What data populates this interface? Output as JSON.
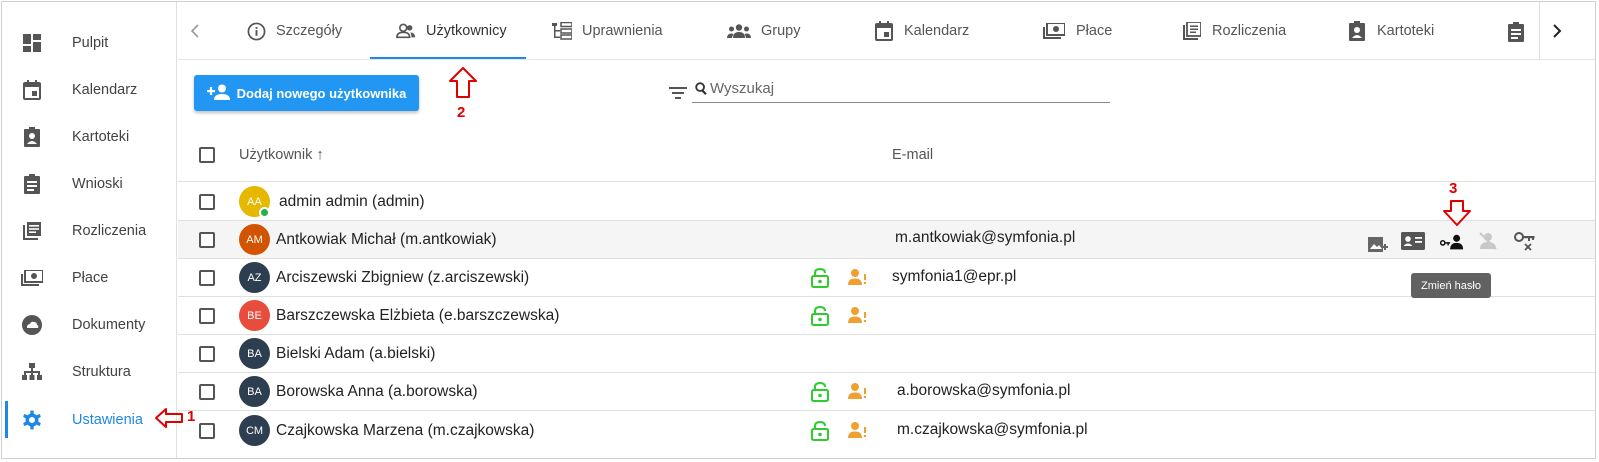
{
  "sidebar": {
    "items": [
      {
        "label": "Pulpit",
        "icon": "dashboard-icon"
      },
      {
        "label": "Kalendarz",
        "icon": "calendar-icon"
      },
      {
        "label": "Kartoteki",
        "icon": "badge-icon"
      },
      {
        "label": "Wnioski",
        "icon": "clipboard-icon"
      },
      {
        "label": "Rozliczenia",
        "icon": "list-icon"
      },
      {
        "label": "Płace",
        "icon": "money-icon"
      },
      {
        "label": "Dokumenty",
        "icon": "cloud-icon"
      },
      {
        "label": "Struktura",
        "icon": "hierarchy-icon"
      },
      {
        "label": "Ustawienia",
        "icon": "gear-icon",
        "active": true
      }
    ]
  },
  "tabs": {
    "items": [
      {
        "label": "Szczegóły",
        "icon": "info-icon"
      },
      {
        "label": "Użytkownicy",
        "icon": "users-icon",
        "active": true
      },
      {
        "label": "Uprawnienia",
        "icon": "tree-icon"
      },
      {
        "label": "Grupy",
        "icon": "groups-icon"
      },
      {
        "label": "Kalendarz",
        "icon": "calendar-icon"
      },
      {
        "label": "Płace",
        "icon": "money-icon"
      },
      {
        "label": "Rozliczenia",
        "icon": "list-icon"
      },
      {
        "label": "Kartoteki",
        "icon": "badge-icon"
      }
    ]
  },
  "toolbar": {
    "add_label": "Dodaj nowego użytkownika",
    "search_placeholder": "Wyszukaj"
  },
  "table": {
    "headers": {
      "user": "Użytkownik",
      "sort_arrow": "↑",
      "email": "E-mail"
    },
    "rows": [
      {
        "initials": "AA",
        "name": "admin admin (admin)",
        "email": "",
        "avatar_color": "#e6b800",
        "online": true,
        "lock": false,
        "warn": false
      },
      {
        "initials": "AM",
        "name": "Antkowiak Michał (m.antkowiak)",
        "email": "m.antkowiak@symfonia.pl",
        "avatar_color": "#d35400",
        "online": false,
        "lock": false,
        "warn": false,
        "hover": true
      },
      {
        "initials": "AZ",
        "name": "Arciszewski Zbigniew (z.arciszewski)",
        "email": "symfonia1@epr.pl",
        "avatar_color": "#2c3e50",
        "online": false,
        "lock": true,
        "warn": true
      },
      {
        "initials": "BE",
        "name": "Barszczewska Elżbieta (e.barszczewska)",
        "email": "",
        "avatar_color": "#e74c3c",
        "online": false,
        "lock": true,
        "warn": true
      },
      {
        "initials": "BA",
        "name": "Bielski Adam (a.bielski)",
        "email": "",
        "avatar_color": "#2c3e50",
        "online": false,
        "lock": false,
        "warn": false
      },
      {
        "initials": "BA",
        "name": "Borowska Anna (a.borowska)",
        "email": "a.borowska@symfonia.pl",
        "avatar_color": "#2c3e50",
        "online": false,
        "lock": true,
        "warn": true
      },
      {
        "initials": "CM",
        "name": "Czajkowska Marzena (m.czajkowska)",
        "email": "m.czajkowska@symfonia.pl",
        "avatar_color": "#2c3e50",
        "online": false,
        "lock": true,
        "warn": true
      }
    ]
  },
  "tooltip": "Zmień hasło",
  "annotations": {
    "one": "1",
    "two": "2",
    "three": "3"
  },
  "colors": {
    "accent": "#2196f3",
    "lock": "#2ecc2e",
    "warn": "#f0a030",
    "annotation": "#e00000"
  }
}
